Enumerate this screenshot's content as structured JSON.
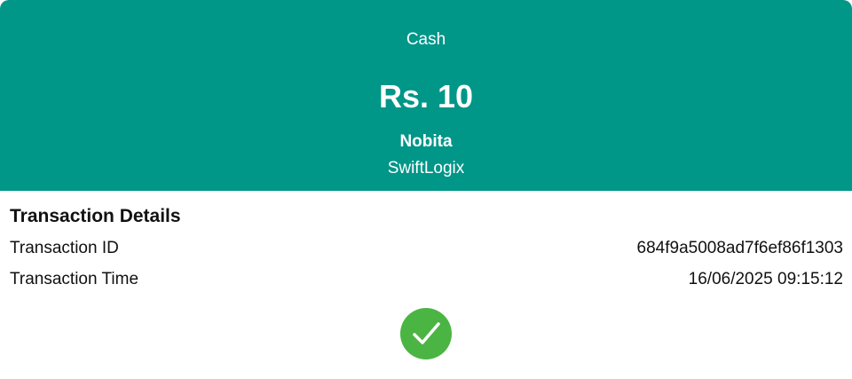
{
  "header": {
    "payment_method": "Cash",
    "amount": "Rs. 10",
    "payer_name": "Nobita",
    "company": "SwiftLogix"
  },
  "details": {
    "title": "Transaction Details",
    "rows": [
      {
        "label": "Transaction ID",
        "value": "684f9a5008ad7f6ef86f1303"
      },
      {
        "label": "Transaction Time",
        "value": "16/06/2025 09:15:12"
      }
    ]
  },
  "status": {
    "icon": "success-check-icon",
    "color": "#4bb543"
  },
  "colors": {
    "header_bg": "#009688",
    "header_text": "#ffffff"
  }
}
